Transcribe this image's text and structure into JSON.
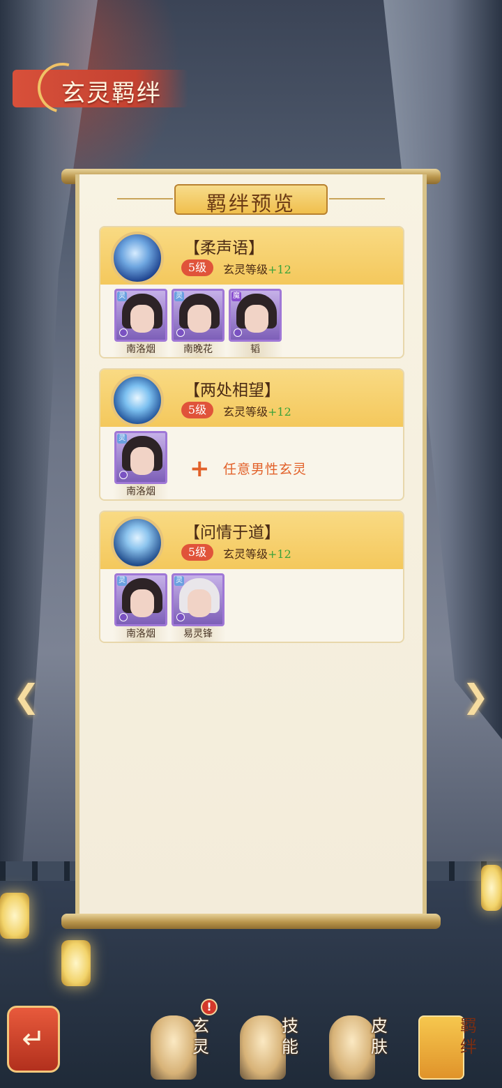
{
  "title": "玄灵羁绊",
  "panel_title": "羁绊预览",
  "bonds": [
    {
      "name": "【柔声语】",
      "level": "5级",
      "attr_label": "玄灵等级",
      "attr_bonus": "+12",
      "icon": "blue-moon-icon",
      "members": [
        {
          "name": "南洛烟",
          "badge": "灵"
        },
        {
          "name": "南晚花",
          "badge": "灵"
        },
        {
          "name": "韬",
          "badge": "魔"
        }
      ]
    },
    {
      "name": "【两处相望】",
      "level": "5级",
      "attr_label": "玄灵等级",
      "attr_bonus": "+12",
      "icon": "blue-lotus-icon",
      "members": [
        {
          "name": "南洛烟",
          "badge": "灵"
        }
      ],
      "any_slot": "任意男性玄灵"
    },
    {
      "name": "【问情于道】",
      "level": "5级",
      "attr_label": "玄灵等级",
      "attr_bonus": "+12",
      "icon": "blue-crystal-icon",
      "members": [
        {
          "name": "南洛烟",
          "badge": "灵"
        },
        {
          "name": "易灵锋",
          "badge": "灵"
        }
      ]
    }
  ],
  "nav": {
    "prev_icon": "chevron-left-icon",
    "next_icon": "chevron-right-icon"
  },
  "tabs": [
    {
      "label": "玄灵",
      "alert": "!"
    },
    {
      "label": "技能"
    },
    {
      "label": "皮肤"
    },
    {
      "label": "羁绊",
      "active": true
    }
  ],
  "colors": {
    "accent_orange": "#e2612a",
    "level_badge": "#e0533a",
    "bonus_green": "#3aa23b",
    "header_gold": "#f4c85c"
  }
}
